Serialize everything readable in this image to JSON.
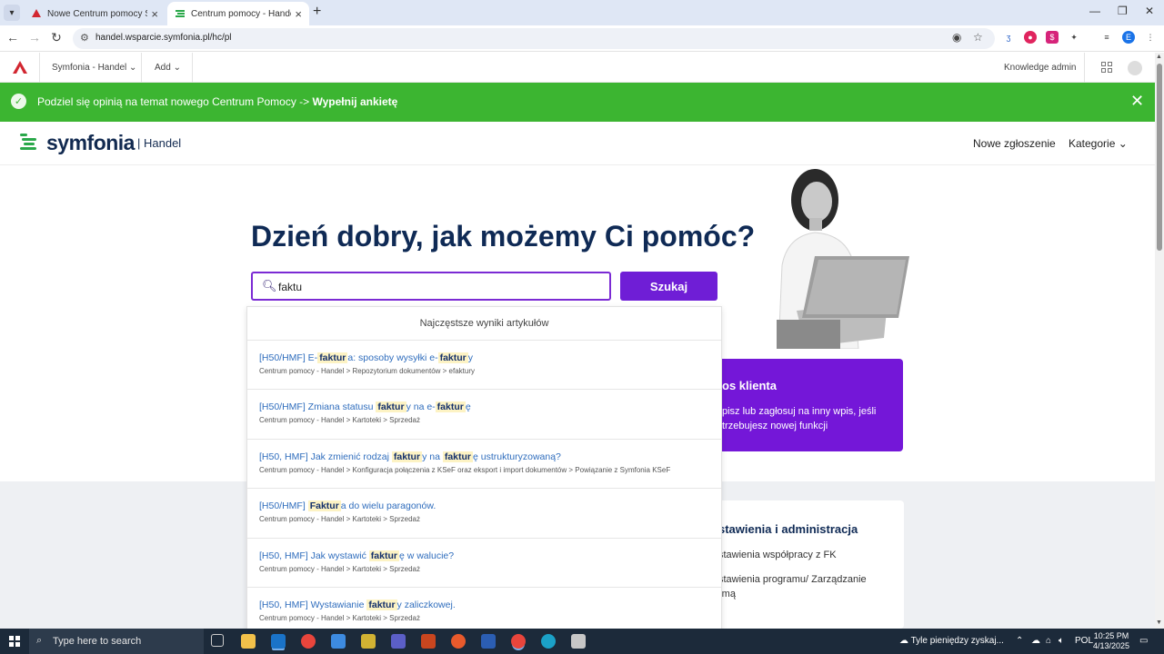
{
  "browser": {
    "tabs": [
      {
        "title": "Nowe Centrum pomocy Symfonia",
        "active": false
      },
      {
        "title": "Centrum pomocy - Handel",
        "active": true
      }
    ],
    "url": "handel.wsparcie.symfonia.pl/hc/pl",
    "profile_initial": "E",
    "accent": "#dfe7f5"
  },
  "adminbar": {
    "brand_menu": "Symfonia - Handel",
    "add_menu": "Add",
    "user_role": "Knowledge admin"
  },
  "banner": {
    "text": "Podziel się opinią na temat nowego Centrum Pomocy ->",
    "link": "Wypełnij ankietę",
    "color": "#3cb531"
  },
  "header": {
    "brand": "symfonia",
    "brand_sub": "| Handel",
    "nav_new_ticket": "Nowe zgłoszenie",
    "nav_categories": "Kategorie"
  },
  "hero": {
    "title": "Dzień dobry, jak możemy Ci pomóc?",
    "search_value": "faktu",
    "search_button": "Szukaj",
    "accent": "#6f1ed6"
  },
  "dropdown": {
    "heading": "Najczęstsze wyniki artykułów",
    "results": [
      {
        "pre": "[H50/HMF] E-",
        "hl1": "faktur",
        "mid": "a: sposoby wysyłki e-",
        "hl2": "faktur",
        "post": "y",
        "path": "Centrum pomocy - Handel > Repozytorium dokumentów > efaktury"
      },
      {
        "pre": "[H50/HMF] Zmiana statusu ",
        "hl1": "faktur",
        "mid": "y na e-",
        "hl2": "faktur",
        "post": "ę",
        "path": "Centrum pomocy - Handel > Kartoteki > Sprzedaż"
      },
      {
        "pre": "[H50, HMF] Jak zmienić rodzaj ",
        "hl1": "faktur",
        "mid": "y na ",
        "hl2": "faktur",
        "post": "ę ustrukturyzowaną?",
        "path": "Centrum pomocy - Handel > Konfiguracja połączenia z KSeF oraz eksport i import dokumentów > Powiązanie z Symfonia KSeF"
      },
      {
        "pre": "[H50/HMF] ",
        "hl1": "Faktur",
        "mid": "a do wielu paragonów.",
        "hl2": "",
        "post": "",
        "path": "Centrum pomocy - Handel > Kartoteki > Sprzedaż"
      },
      {
        "pre": "[H50, HMF] Jak wystawić ",
        "hl1": "faktur",
        "mid": "ę w walucie?",
        "hl2": "",
        "post": "",
        "path": "Centrum pomocy - Handel > Kartoteki > Sprzedaż"
      },
      {
        "pre": "[H50, HMF] Wystawianie ",
        "hl1": "faktur",
        "mid": "y zaliczkowej.",
        "hl2": "",
        "post": "",
        "path": "Centrum pomocy - Handel > Kartoteki > Sprzedaż"
      }
    ]
  },
  "purple_box": {
    "title": "os klienta",
    "text": "pisz lub zagłosuj na inny wpis, jeśli trzebujesz nowej funkcji",
    "color": "#7417d8"
  },
  "settings_card": {
    "title": "stawienia i administracja",
    "link1": "stawienia współpracy z FK",
    "link2_line1": "stawienia programu/ Zarządzanie",
    "link2_line2": "rmą"
  },
  "taskbar": {
    "search_placeholder": "Type here to search",
    "weather": "Tyle pieniędzy zyskaj...",
    "language": "POL",
    "time": "10:25 PM",
    "date": "4/13/2025"
  }
}
